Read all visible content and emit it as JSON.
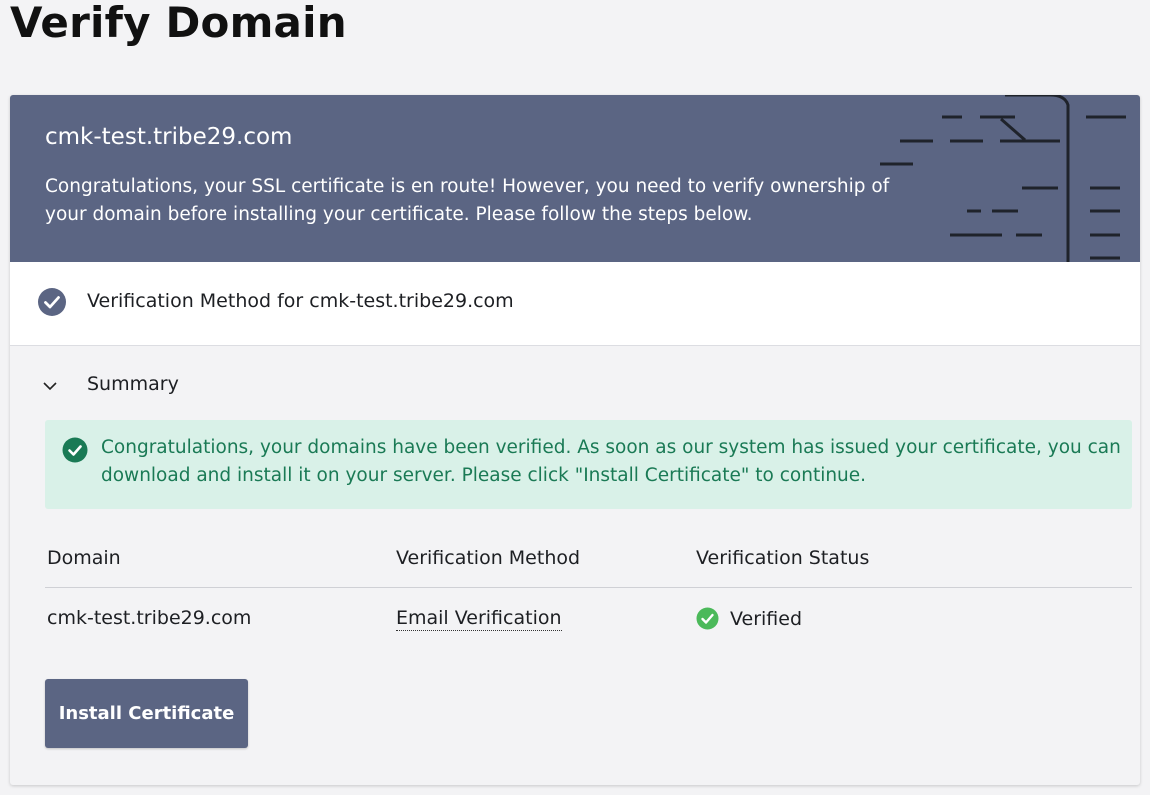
{
  "page": {
    "title": "Verify Domain"
  },
  "hero": {
    "domain": "cmk-test.tribe29.com",
    "message": "Congratulations, your SSL certificate is en route! However, you need to verify ownership of your domain before installing your certificate. Please follow the steps below."
  },
  "step": {
    "label": "Verification Method for cmk-test.tribe29.com",
    "icon": "check-circle-icon"
  },
  "summary": {
    "label": "Summary",
    "icon": "chevron-down-icon"
  },
  "alert": {
    "icon": "check-circle-icon",
    "text": "Congratulations, your domains have been verified. As soon as our system has issued your certificate, you can download and install it on your server. Please click \"Install Certificate\" to continue."
  },
  "table": {
    "headers": [
      "Domain",
      "Verification Method",
      "Verification Status"
    ],
    "rows": [
      {
        "domain": "cmk-test.tribe29.com",
        "method": "Email Verification",
        "status": "Verified",
        "status_icon": "check-circle-icon"
      }
    ]
  },
  "actions": {
    "install_label": "Install Certificate"
  },
  "colors": {
    "brand": "#5b6583",
    "success_bg": "#d9f1e8",
    "success_text": "#1a7a55",
    "success_icon": "#4bb95a"
  }
}
